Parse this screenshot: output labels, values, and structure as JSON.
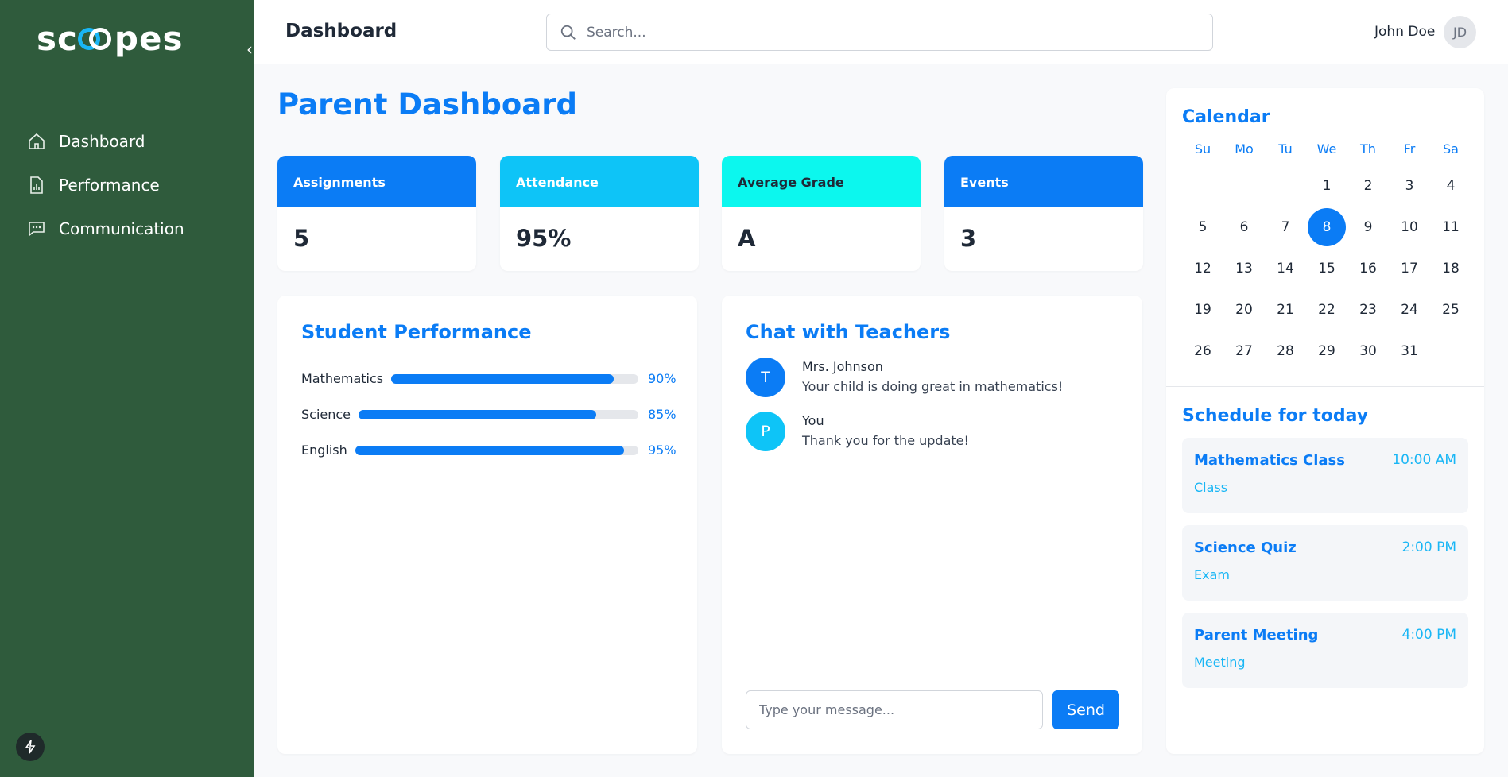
{
  "sidebar": {
    "logo": "scopes",
    "items": [
      {
        "label": "Dashboard",
        "icon": "home-icon"
      },
      {
        "label": "Performance",
        "icon": "chart-file-icon"
      },
      {
        "label": "Communication",
        "icon": "message-icon"
      }
    ]
  },
  "header": {
    "title": "Dashboard",
    "search_placeholder": "Search...",
    "user_name": "John Doe",
    "avatar_initials": "JD"
  },
  "main": {
    "title": "Parent Dashboard",
    "stats": [
      {
        "label": "Assignments",
        "value": "5",
        "color": "#0b7cf5"
      },
      {
        "label": "Attendance",
        "value": "95%",
        "color": "#0ec4f7"
      },
      {
        "label": "Average Grade",
        "value": "A",
        "color": "#0cf7ee"
      },
      {
        "label": "Events",
        "value": "3",
        "color": "#0b7cf5"
      }
    ],
    "performance": {
      "title": "Student Performance",
      "subjects": [
        {
          "name": "Mathematics",
          "percent": 90,
          "label": "90%"
        },
        {
          "name": "Science",
          "percent": 85,
          "label": "85%"
        },
        {
          "name": "English",
          "percent": 95,
          "label": "95%"
        }
      ]
    },
    "chat": {
      "title": "Chat with Teachers",
      "messages": [
        {
          "initial": "T",
          "sender": "Mrs. Johnson",
          "text": "Your child is doing great in mathematics!",
          "color": "#0b7cf5"
        },
        {
          "initial": "P",
          "sender": "You",
          "text": "Thank you for the update!",
          "color": "#0ec4f7"
        }
      ],
      "input_placeholder": "Type your message...",
      "send_label": "Send"
    }
  },
  "calendar": {
    "title": "Calendar",
    "weekdays": [
      "Su",
      "Mo",
      "Tu",
      "We",
      "Th",
      "Fr",
      "Sa"
    ],
    "leading_blanks": 3,
    "days": [
      "1",
      "2",
      "3",
      "4",
      "5",
      "6",
      "7",
      "8",
      "9",
      "10",
      "11",
      "12",
      "13",
      "14",
      "15",
      "16",
      "17",
      "18",
      "19",
      "20",
      "21",
      "22",
      "23",
      "24",
      "25",
      "26",
      "27",
      "28",
      "29",
      "30",
      "31"
    ],
    "selected_day": "8"
  },
  "schedule": {
    "title": "Schedule for today",
    "items": [
      {
        "title": "Mathematics Class",
        "time": "10:00 AM",
        "type": "Class"
      },
      {
        "title": "Science Quiz",
        "time": "2:00 PM",
        "type": "Exam"
      },
      {
        "title": "Parent Meeting",
        "time": "4:00 PM",
        "type": "Meeting"
      }
    ]
  }
}
